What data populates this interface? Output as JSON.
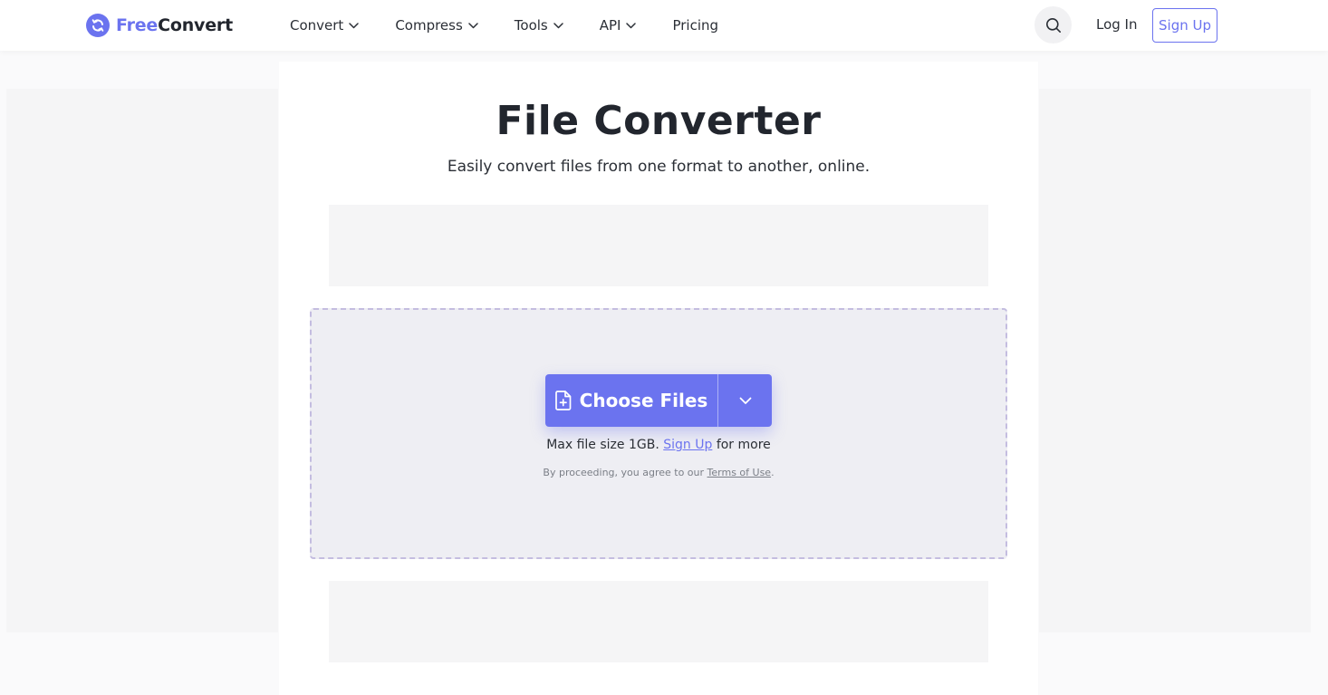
{
  "header": {
    "logo": {
      "free": "Free",
      "convert": "Convert"
    },
    "nav": [
      {
        "label": "Convert",
        "has_dropdown": true
      },
      {
        "label": "Compress",
        "has_dropdown": true
      },
      {
        "label": "Tools",
        "has_dropdown": true
      },
      {
        "label": "API",
        "has_dropdown": true
      },
      {
        "label": "Pricing",
        "has_dropdown": false
      }
    ],
    "search_icon": "search-icon",
    "login_label": "Log In",
    "signup_label": "Sign Up"
  },
  "main": {
    "title": "File Converter",
    "subtitle": "Easily convert files from one format to another, online."
  },
  "uploader": {
    "choose_label": "Choose Files",
    "file_icon": "file-plus-icon",
    "dropdown_icon": "chevron-down-icon",
    "max_size_prefix": "Max file size 1GB.",
    "max_size_link": "Sign Up",
    "max_size_suffix": "for more",
    "terms_prefix": "By proceeding, you agree to our",
    "terms_link": "Terms of Use",
    "terms_suffix": "."
  },
  "colors": {
    "accent": "#6b73ef",
    "dropzone_bg": "#eeeef3",
    "dropzone_border": "#c4bde0",
    "text": "#22262e"
  }
}
